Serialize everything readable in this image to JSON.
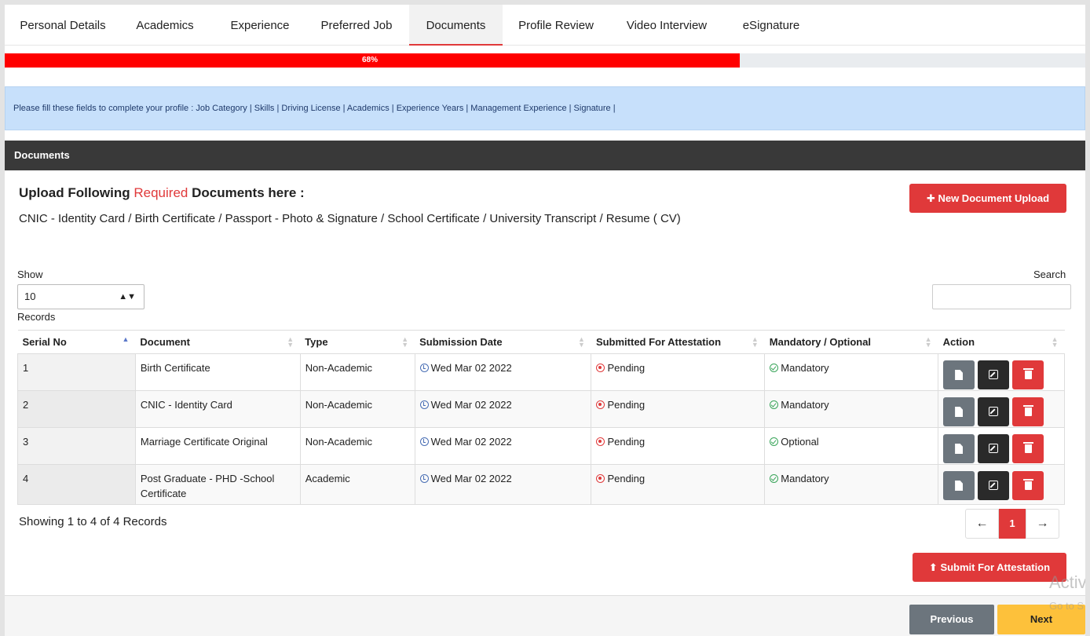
{
  "tabs": [
    {
      "label": "Personal Details"
    },
    {
      "label": "Academics"
    },
    {
      "label": "Experience"
    },
    {
      "label": "Preferred Job"
    },
    {
      "label": "Documents"
    },
    {
      "label": "Profile Review"
    },
    {
      "label": "Video Interview"
    },
    {
      "label": "eSignature"
    }
  ],
  "active_tab": "Documents",
  "progress": {
    "label": "68%",
    "value_percent": 68,
    "color": "#ff0000"
  },
  "alert": {
    "text": "Please fill these fields to complete your profile : Job Category | Skills | Driving License | Academics | Experience Years | Management Experience | Signature |"
  },
  "panel": {
    "title": "Documents"
  },
  "upload": {
    "title_prefix": "Upload Following ",
    "title_required": "Required",
    "title_suffix": " Documents here :",
    "doc_list": "CNIC - Identity Card / Birth Certificate / Passport - Photo & Signature / School Certificate / University Transcript / Resume ( CV)",
    "new_button": "New Document Upload"
  },
  "controls": {
    "show_label": "Show",
    "page_size": "10",
    "records_label": "Records",
    "search_label": "Search"
  },
  "table": {
    "headers": [
      "Serial No",
      "Document",
      "Type",
      "Submission Date",
      "Submitted For Attestation",
      "Mandatory / Optional",
      "Action"
    ],
    "rows": [
      {
        "serial": "1",
        "document": "Birth Certificate",
        "type": "Non-Academic",
        "date": "Wed Mar 02 2022",
        "attestation": "Pending",
        "mandatory": "Mandatory"
      },
      {
        "serial": "2",
        "document": "CNIC - Identity Card",
        "type": "Non-Academic",
        "date": "Wed Mar 02 2022",
        "attestation": "Pending",
        "mandatory": "Mandatory"
      },
      {
        "serial": "3",
        "document": "Marriage Certificate Original",
        "type": "Non-Academic",
        "date": "Wed Mar 02 2022",
        "attestation": "Pending",
        "mandatory": "Optional"
      },
      {
        "serial": "4",
        "document": "Post Graduate - PHD -School Certificate",
        "type": "Academic",
        "date": "Wed Mar 02 2022",
        "attestation": "Pending",
        "mandatory": "Mandatory"
      }
    ]
  },
  "showing": "Showing 1 to 4 of 4 Records",
  "pager": {
    "prev": "←",
    "current": "1",
    "next": "→"
  },
  "submit_button": "Submit For Attestation",
  "footer": {
    "previous": "Previous",
    "next": "Next"
  },
  "watermark": {
    "line1": "Activ",
    "line2": "Go to S"
  },
  "colors": {
    "accent_red": "#e0393a",
    "next_yellow": "#fdc13b",
    "alert_blue": "#c7e0fb",
    "panel_dark": "#393939"
  }
}
